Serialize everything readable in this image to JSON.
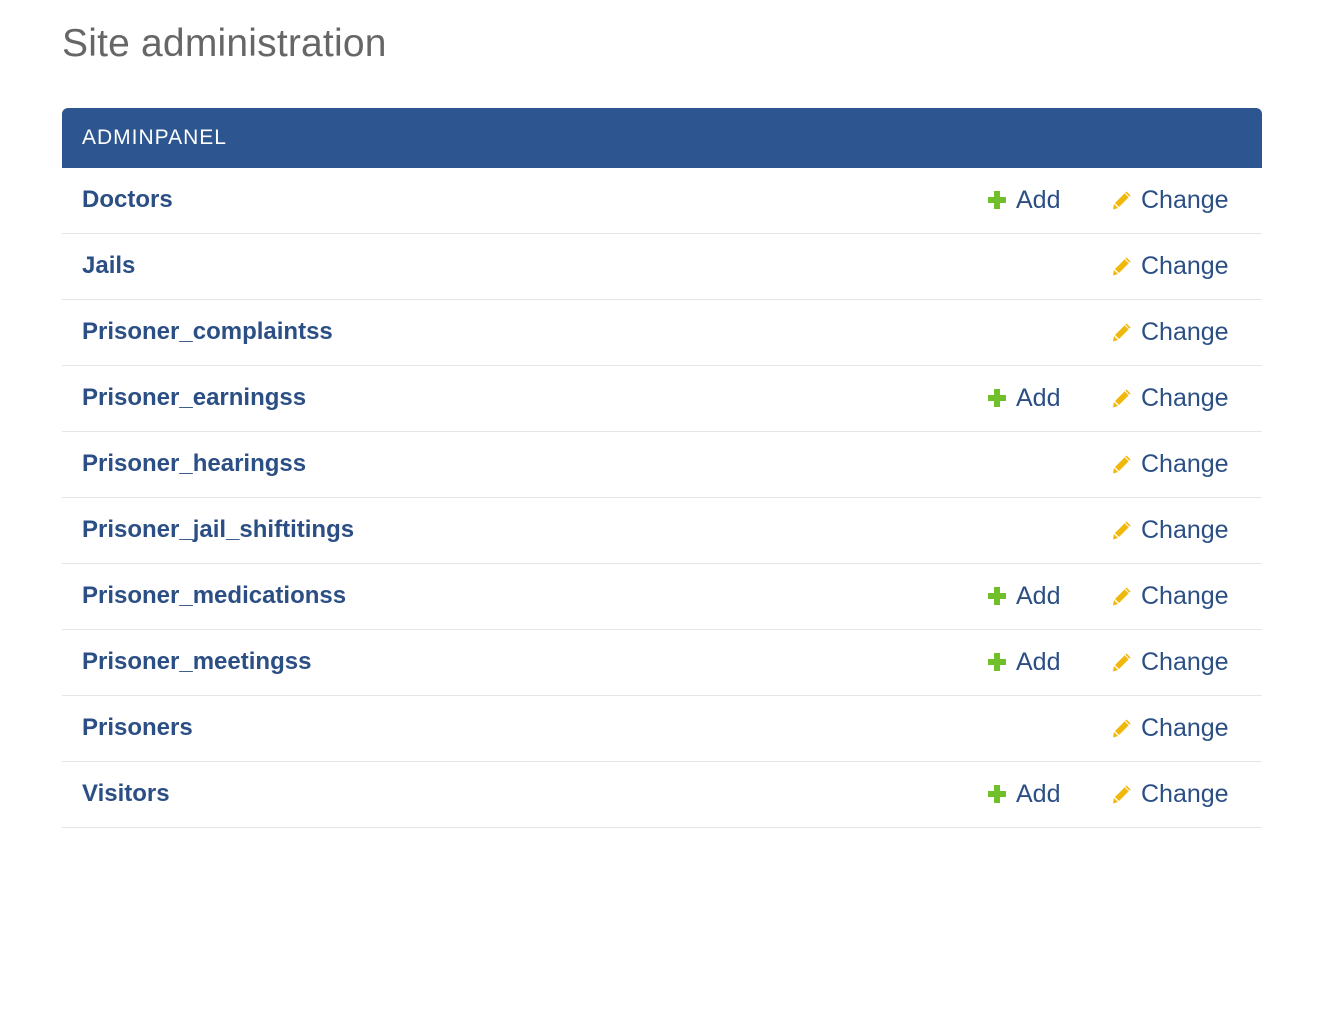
{
  "page": {
    "title": "Site administration"
  },
  "app": {
    "caption": "ADMINPANEL",
    "add_label": "Add",
    "change_label": "Change",
    "colors": {
      "header_bg": "#2d5690",
      "link": "#2b4f85",
      "add_icon": "#70bf2b",
      "change_icon": "#efb80b"
    },
    "models": [
      {
        "name": "Doctors",
        "has_add": true,
        "has_change": true
      },
      {
        "name": "Jails",
        "has_add": false,
        "has_change": true
      },
      {
        "name": "Prisoner_complaintss",
        "has_add": false,
        "has_change": true
      },
      {
        "name": "Prisoner_earningss",
        "has_add": true,
        "has_change": true
      },
      {
        "name": "Prisoner_hearingss",
        "has_add": false,
        "has_change": true
      },
      {
        "name": "Prisoner_jail_shiftitings",
        "has_add": false,
        "has_change": true
      },
      {
        "name": "Prisoner_medicationss",
        "has_add": true,
        "has_change": true
      },
      {
        "name": "Prisoner_meetingss",
        "has_add": true,
        "has_change": true
      },
      {
        "name": "Prisoners",
        "has_add": false,
        "has_change": true
      },
      {
        "name": "Visitors",
        "has_add": true,
        "has_change": true
      }
    ],
    "icons": {
      "add": "plus-icon",
      "change": "pencil-icon"
    }
  }
}
